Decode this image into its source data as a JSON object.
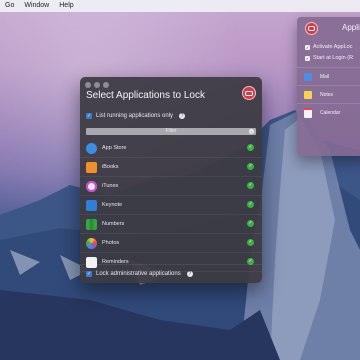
{
  "menubar": {
    "items": [
      "Go",
      "Window",
      "Help"
    ]
  },
  "main_window": {
    "title": "Select Applications to Lock",
    "list_running_label": "List running applications only",
    "filter_placeholder": "Filter",
    "apps": [
      {
        "name": "App Store",
        "icon": "app-store-icon",
        "color": "#3b8ee8"
      },
      {
        "name": "iBooks",
        "icon": "ibooks-icon",
        "color": "#f0902a"
      },
      {
        "name": "iTunes",
        "icon": "itunes-icon",
        "color": "#e9e6ef"
      },
      {
        "name": "Keynote",
        "icon": "keynote-icon",
        "color": "#2f7ed8"
      },
      {
        "name": "Numbers",
        "icon": "numbers-icon",
        "color": "#36a642"
      },
      {
        "name": "Photos",
        "icon": "photos-icon",
        "color": "#f4c542"
      },
      {
        "name": "Reminders",
        "icon": "reminders-icon",
        "color": "#f2f2f2"
      }
    ],
    "lock_admin_label": "Lock administrative applications"
  },
  "popover": {
    "title": "Applica",
    "activate_label": "Activate AppLoc",
    "start_login_label": "Start at Login (R",
    "items": [
      {
        "name": "Mail",
        "icon": "mail-icon",
        "color": "#4a90e2"
      },
      {
        "name": "Notes",
        "icon": "notes-icon",
        "color": "#f5d64a"
      },
      {
        "name": "Calendar",
        "icon": "calendar-icon",
        "color": "#f3f3f3"
      }
    ]
  },
  "colors": {
    "accent": "#3a7bd5",
    "status_ok": "#3cb043",
    "brand": "#d93a4a"
  }
}
